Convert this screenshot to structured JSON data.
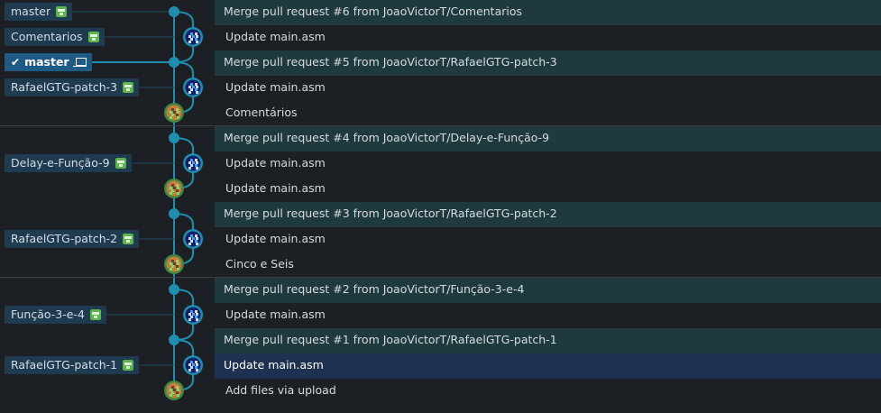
{
  "colors": {
    "background": "#1c2024",
    "graph_line": "#1e8fb0",
    "branch_tag": "#1f3b50",
    "current_branch_tag": "#1d5a86",
    "merge_row": "#1f3a3e",
    "selected_row": "#1e3151",
    "avatar_blue_ring": "#1e8fb0",
    "avatar_green_ring": "#3e8a3f"
  },
  "branch_labels": [
    {
      "row": 0,
      "name": "master",
      "current": false,
      "icon": "remote-icon"
    },
    {
      "row": 1,
      "name": "Comentarios",
      "current": false,
      "icon": "remote-icon"
    },
    {
      "row": 2,
      "name": "master",
      "current": true,
      "icon": "laptop-icon",
      "check_icon": "✔"
    },
    {
      "row": 3,
      "name": "RafaelGTG-patch-3",
      "current": false,
      "icon": "remote-icon"
    },
    {
      "row": 6,
      "name": "Delay-e-Função-9",
      "current": false,
      "icon": "remote-icon"
    },
    {
      "row": 9,
      "name": "RafaelGTG-patch-2",
      "current": false,
      "icon": "remote-icon"
    },
    {
      "row": 12,
      "name": "Função-3-e-4",
      "current": false,
      "icon": "remote-icon"
    },
    {
      "row": 14,
      "name": "RafaelGTG-patch-1",
      "current": false,
      "icon": "remote-icon"
    }
  ],
  "commits": [
    {
      "message": "Merge pull request #6 from JoaoVictorT/Comentarios",
      "kind": "merge",
      "avatar": "dot"
    },
    {
      "message": "Update main.asm",
      "kind": "normal",
      "avatar": "blue-pixel-avatar"
    },
    {
      "message": "Merge pull request #5 from JoaoVictorT/RafaelGTG-patch-3",
      "kind": "merge",
      "avatar": "dot"
    },
    {
      "message": "Update main.asm",
      "kind": "normal",
      "avatar": "blue-pixel-avatar"
    },
    {
      "message": "Comentários",
      "kind": "normal",
      "avatar": "green-pixel-avatar"
    },
    {
      "message": "Merge pull request #4 from JoaoVictorT/Delay-e-Função-9",
      "kind": "merge",
      "avatar": "dot"
    },
    {
      "message": "Update main.asm",
      "kind": "normal",
      "avatar": "blue-pixel-avatar"
    },
    {
      "message": "Update main.asm",
      "kind": "normal",
      "avatar": "green-pixel-avatar"
    },
    {
      "message": "Merge pull request #3 from JoaoVictorT/RafaelGTG-patch-2",
      "kind": "merge",
      "avatar": "dot"
    },
    {
      "message": "Update main.asm",
      "kind": "normal",
      "avatar": "blue-pixel-avatar"
    },
    {
      "message": "Cinco e Seis",
      "kind": "normal",
      "avatar": "green-pixel-avatar"
    },
    {
      "message": "Merge pull request #2 from JoaoVictorT/Função-3-e-4",
      "kind": "merge",
      "avatar": "dot"
    },
    {
      "message": "Update main.asm",
      "kind": "normal",
      "avatar": "blue-pixel-avatar"
    },
    {
      "message": "Merge pull request #1 from JoaoVictorT/RafaelGTG-patch-1",
      "kind": "merge",
      "avatar": "dot"
    },
    {
      "message": "Update main.asm",
      "kind": "normal",
      "avatar": "blue-pixel-avatar",
      "selected": true
    },
    {
      "message": "Add files via upload",
      "kind": "normal",
      "avatar": "green-pixel-avatar"
    }
  ]
}
